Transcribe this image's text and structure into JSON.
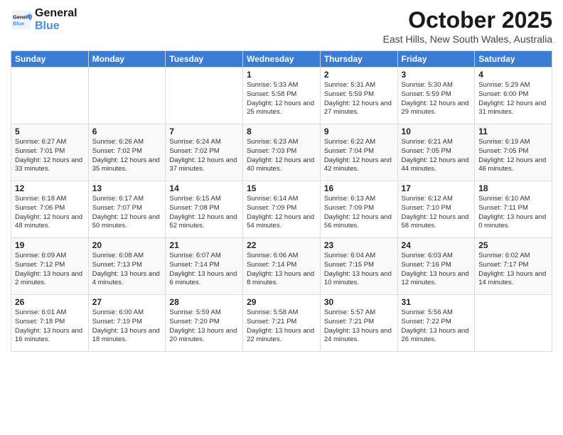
{
  "logo": {
    "line1": "General",
    "line2": "Blue"
  },
  "title": "October 2025",
  "subtitle": "East Hills, New South Wales, Australia",
  "days_of_week": [
    "Sunday",
    "Monday",
    "Tuesday",
    "Wednesday",
    "Thursday",
    "Friday",
    "Saturday"
  ],
  "weeks": [
    [
      {
        "day": "",
        "detail": ""
      },
      {
        "day": "",
        "detail": ""
      },
      {
        "day": "",
        "detail": ""
      },
      {
        "day": "1",
        "detail": "Sunrise: 5:33 AM\nSunset: 5:58 PM\nDaylight: 12 hours\nand 25 minutes."
      },
      {
        "day": "2",
        "detail": "Sunrise: 5:31 AM\nSunset: 5:59 PM\nDaylight: 12 hours\nand 27 minutes."
      },
      {
        "day": "3",
        "detail": "Sunrise: 5:30 AM\nSunset: 5:59 PM\nDaylight: 12 hours\nand 29 minutes."
      },
      {
        "day": "4",
        "detail": "Sunrise: 5:29 AM\nSunset: 6:00 PM\nDaylight: 12 hours\nand 31 minutes."
      }
    ],
    [
      {
        "day": "5",
        "detail": "Sunrise: 6:27 AM\nSunset: 7:01 PM\nDaylight: 12 hours\nand 33 minutes."
      },
      {
        "day": "6",
        "detail": "Sunrise: 6:26 AM\nSunset: 7:02 PM\nDaylight: 12 hours\nand 35 minutes."
      },
      {
        "day": "7",
        "detail": "Sunrise: 6:24 AM\nSunset: 7:02 PM\nDaylight: 12 hours\nand 37 minutes."
      },
      {
        "day": "8",
        "detail": "Sunrise: 6:23 AM\nSunset: 7:03 PM\nDaylight: 12 hours\nand 40 minutes."
      },
      {
        "day": "9",
        "detail": "Sunrise: 6:22 AM\nSunset: 7:04 PM\nDaylight: 12 hours\nand 42 minutes."
      },
      {
        "day": "10",
        "detail": "Sunrise: 6:21 AM\nSunset: 7:05 PM\nDaylight: 12 hours\nand 44 minutes."
      },
      {
        "day": "11",
        "detail": "Sunrise: 6:19 AM\nSunset: 7:05 PM\nDaylight: 12 hours\nand 46 minutes."
      }
    ],
    [
      {
        "day": "12",
        "detail": "Sunrise: 6:18 AM\nSunset: 7:06 PM\nDaylight: 12 hours\nand 48 minutes."
      },
      {
        "day": "13",
        "detail": "Sunrise: 6:17 AM\nSunset: 7:07 PM\nDaylight: 12 hours\nand 50 minutes."
      },
      {
        "day": "14",
        "detail": "Sunrise: 6:15 AM\nSunset: 7:08 PM\nDaylight: 12 hours\nand 52 minutes."
      },
      {
        "day": "15",
        "detail": "Sunrise: 6:14 AM\nSunset: 7:09 PM\nDaylight: 12 hours\nand 54 minutes."
      },
      {
        "day": "16",
        "detail": "Sunrise: 6:13 AM\nSunset: 7:09 PM\nDaylight: 12 hours\nand 56 minutes."
      },
      {
        "day": "17",
        "detail": "Sunrise: 6:12 AM\nSunset: 7:10 PM\nDaylight: 12 hours\nand 58 minutes."
      },
      {
        "day": "18",
        "detail": "Sunrise: 6:10 AM\nSunset: 7:11 PM\nDaylight: 13 hours\nand 0 minutes."
      }
    ],
    [
      {
        "day": "19",
        "detail": "Sunrise: 6:09 AM\nSunset: 7:12 PM\nDaylight: 13 hours\nand 2 minutes."
      },
      {
        "day": "20",
        "detail": "Sunrise: 6:08 AM\nSunset: 7:13 PM\nDaylight: 13 hours\nand 4 minutes."
      },
      {
        "day": "21",
        "detail": "Sunrise: 6:07 AM\nSunset: 7:14 PM\nDaylight: 13 hours\nand 6 minutes."
      },
      {
        "day": "22",
        "detail": "Sunrise: 6:06 AM\nSunset: 7:14 PM\nDaylight: 13 hours\nand 8 minutes."
      },
      {
        "day": "23",
        "detail": "Sunrise: 6:04 AM\nSunset: 7:15 PM\nDaylight: 13 hours\nand 10 minutes."
      },
      {
        "day": "24",
        "detail": "Sunrise: 6:03 AM\nSunset: 7:16 PM\nDaylight: 13 hours\nand 12 minutes."
      },
      {
        "day": "25",
        "detail": "Sunrise: 6:02 AM\nSunset: 7:17 PM\nDaylight: 13 hours\nand 14 minutes."
      }
    ],
    [
      {
        "day": "26",
        "detail": "Sunrise: 6:01 AM\nSunset: 7:18 PM\nDaylight: 13 hours\nand 16 minutes."
      },
      {
        "day": "27",
        "detail": "Sunrise: 6:00 AM\nSunset: 7:19 PM\nDaylight: 13 hours\nand 18 minutes."
      },
      {
        "day": "28",
        "detail": "Sunrise: 5:59 AM\nSunset: 7:20 PM\nDaylight: 13 hours\nand 20 minutes."
      },
      {
        "day": "29",
        "detail": "Sunrise: 5:58 AM\nSunset: 7:21 PM\nDaylight: 13 hours\nand 22 minutes."
      },
      {
        "day": "30",
        "detail": "Sunrise: 5:57 AM\nSunset: 7:21 PM\nDaylight: 13 hours\nand 24 minutes."
      },
      {
        "day": "31",
        "detail": "Sunrise: 5:56 AM\nSunset: 7:22 PM\nDaylight: 13 hours\nand 26 minutes."
      },
      {
        "day": "",
        "detail": ""
      }
    ]
  ]
}
